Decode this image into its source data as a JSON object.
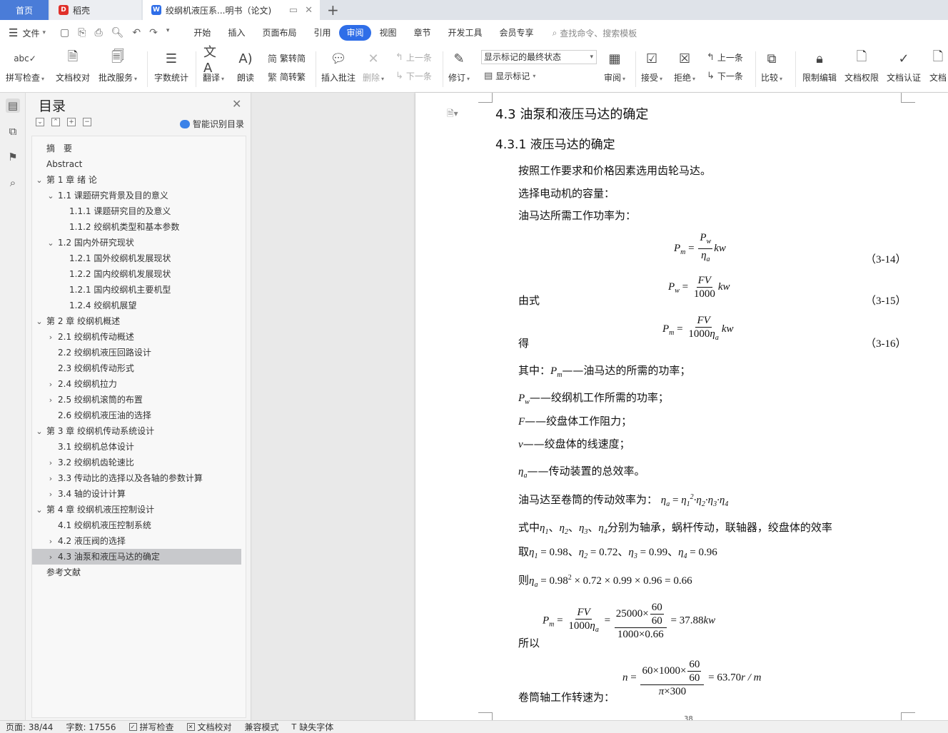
{
  "tabs": {
    "home": "首页",
    "doc1": "稻壳",
    "doc2": "绞纲机液压系...明书（论文)"
  },
  "menubar": {
    "file": "文件",
    "items": [
      "开始",
      "插入",
      "页面布局",
      "引用",
      "审阅",
      "视图",
      "章节",
      "开发工具",
      "会员专享"
    ],
    "active": "审阅",
    "search": "查找命令、搜索模板"
  },
  "ribbon": {
    "spell": "拼写检查",
    "proof": "文档校对",
    "batch": "批改服务",
    "wordcount": "字数统计",
    "translate": "翻译",
    "read": "朗读",
    "trad": "繁转简",
    "simp": "简转繁",
    "insert_comment": "插入批注",
    "delete": "删除",
    "prev": "上一条",
    "next": "下一条",
    "revise": "修订",
    "display_select": "显示标记的最终状态",
    "show_marks": "显示标记",
    "review": "审阅",
    "accept": "接受",
    "reject": "拒绝",
    "prev2": "上一条",
    "next2": "下一条",
    "compare": "比较",
    "restrict": "限制编辑",
    "permission": "文档权限",
    "certify": "文档认证",
    "more": "文档"
  },
  "toc": {
    "title": "目录",
    "smart": "智能识别目录",
    "items": [
      {
        "label": "摘　要",
        "level": 0,
        "arrow": ""
      },
      {
        "label": "Abstract",
        "level": 0,
        "arrow": ""
      },
      {
        "label": "第 1 章  绪  论",
        "level": 0,
        "arrow": "v"
      },
      {
        "label": "1.1  课题研究背景及目的意义",
        "level": 1,
        "arrow": "v"
      },
      {
        "label": "1.1.1  课题研究目的及意义",
        "level": 2,
        "arrow": ""
      },
      {
        "label": "1.1.2  绞纲机类型和基本参数",
        "level": 2,
        "arrow": ""
      },
      {
        "label": "1.2  国内外研究现状",
        "level": 1,
        "arrow": "v"
      },
      {
        "label": "1.2.1  国外绞纲机发展现状",
        "level": 2,
        "arrow": ""
      },
      {
        "label": "1.2.2  国内绞纲机发展现状",
        "level": 2,
        "arrow": ""
      },
      {
        "label": "1.2.1  国内绞纲机主要机型",
        "level": 2,
        "arrow": ""
      },
      {
        "label": "1.2.4  绞纲机展望",
        "level": 2,
        "arrow": ""
      },
      {
        "label": "第 2 章  绞纲机概述",
        "level": 0,
        "arrow": "v"
      },
      {
        "label": "2.1  绞纲机传动概述",
        "level": 1,
        "arrow": ">"
      },
      {
        "label": "2.2  绞纲机液压回路设计",
        "level": 1,
        "arrow": ""
      },
      {
        "label": "2.3  绞纲机传动形式",
        "level": 1,
        "arrow": ""
      },
      {
        "label": "2.4  绞纲机拉力",
        "level": 1,
        "arrow": ">"
      },
      {
        "label": "2.5  绞纲机滚筒的布置",
        "level": 1,
        "arrow": ">"
      },
      {
        "label": "2.6  绞纲机液压油的选择",
        "level": 1,
        "arrow": ""
      },
      {
        "label": "第 3 章  绞纲机传动系统设计",
        "level": 0,
        "arrow": "v"
      },
      {
        "label": "3.1  绞纲机总体设计",
        "level": 1,
        "arrow": ""
      },
      {
        "label": "3.2  绞纲机齿轮速比",
        "level": 1,
        "arrow": ">"
      },
      {
        "label": "3.3  传动比的选择以及各轴的参数计算",
        "level": 1,
        "arrow": ">"
      },
      {
        "label": "3.4  轴的设计计算",
        "level": 1,
        "arrow": ">"
      },
      {
        "label": "第 4 章  绞纲机液压控制设计",
        "level": 0,
        "arrow": "v"
      },
      {
        "label": "4.1  绞纲机液压控制系统",
        "level": 1,
        "arrow": ""
      },
      {
        "label": "4.2  液压阀的选择",
        "level": 1,
        "arrow": ">"
      },
      {
        "label": "4.3  油泵和液压马达的确定",
        "level": 1,
        "arrow": ">",
        "selected": true
      },
      {
        "label": "参考文献",
        "level": 0,
        "arrow": ""
      }
    ]
  },
  "doc": {
    "h2": "4.3  油泵和液压马达的确定",
    "h3": "4.3.1  液压马达的确定",
    "p1": "按照工作要求和价格因素选用齿轮马达。",
    "p2": "选择电动机的容量：",
    "p3": "油马达所需工作功率为：",
    "eq14": "（3-14）",
    "yous": "由式",
    "eq15": "（3-15）",
    "de": "得",
    "eq16": "（3-16）",
    "where_pm": "——油马达的所需的功率；",
    "where_pm_prefix": "其中：",
    "where_pw": "——绞纲机工作所需的功率；",
    "where_f": "——绞盘体工作阻力；",
    "where_v": "——绞盘体的线速度；",
    "where_eta": "——传动装置的总效率。",
    "eff_text": "油马达至卷筒的传动效率为：",
    "eff_desc_pre": "式中",
    "eff_desc_post": "分别为轴承，蜗杆传动，联轴器，绞盘体的效率",
    "take": "取",
    "v1": "0.98",
    "v2": "0.72",
    "v3": "0.99",
    "v4": "0.96",
    "then": "则",
    "then_result": "0.66",
    "so": "所以",
    "so_result": "37.88",
    "speed_text": "卷筒轴工作转速为：",
    "speed_result": "63.70",
    "n25000": "25000",
    "n60": "60",
    "n1000": "1000",
    "n066": "0.66",
    "page_no": "38"
  },
  "status": {
    "page": "页面: 38/44",
    "words": "字数: 17556",
    "spell": "拼写检查",
    "proof": "文档校对",
    "compat": "兼容模式",
    "font": "缺失字体"
  }
}
